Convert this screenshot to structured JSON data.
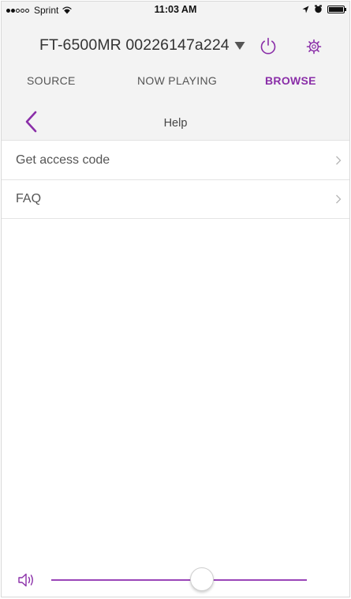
{
  "status_bar": {
    "carrier": "Sprint",
    "time": "11:03 AM",
    "signal_strength": 2
  },
  "device": {
    "name": "FT-6500MR 00226147a224",
    "dropdown_icon": "triangle-down-icon",
    "power_icon": "power-icon",
    "settings_icon": "gear-icon"
  },
  "tabs": [
    {
      "label": "SOURCE",
      "active": false
    },
    {
      "label": "NOW PLAYING",
      "active": false
    },
    {
      "label": "BROWSE",
      "active": true
    }
  ],
  "nav": {
    "back_icon": "chevron-left-icon",
    "title": "Help"
  },
  "list_items": [
    {
      "label": "Get access code",
      "icon": "chevron-right-icon"
    },
    {
      "label": "FAQ",
      "icon": "chevron-right-icon"
    }
  ],
  "volume": {
    "icon": "speaker-icon",
    "level": 0.59
  },
  "colors": {
    "accent": "#8a2ea8",
    "track": "#9a45b8",
    "header_background": "#f3f3f3"
  }
}
